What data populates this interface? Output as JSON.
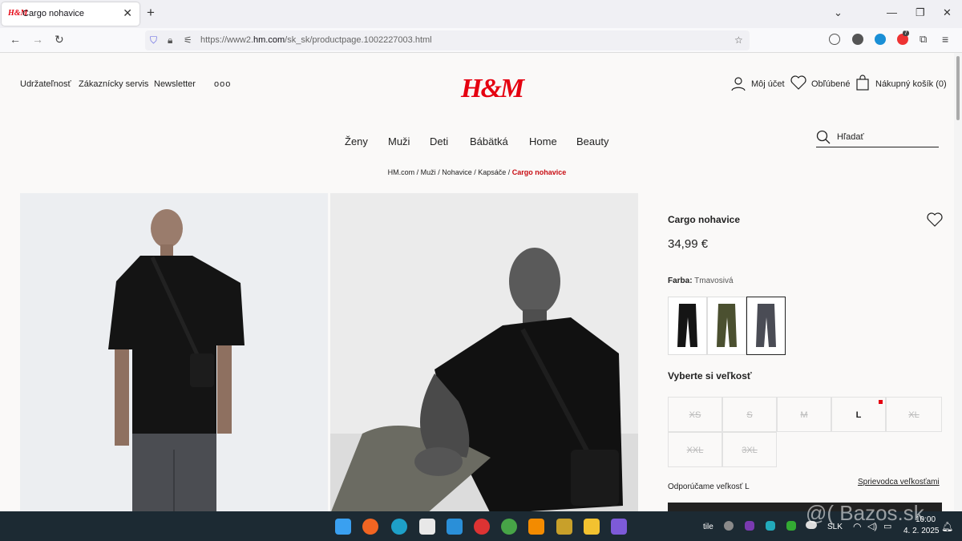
{
  "browser": {
    "tab_title": "Cargo nohavice",
    "tab_favicon_text": "H&M",
    "url_prefix": "https://www2.",
    "url_domain": "hm.com",
    "url_path": "/sk_sk/productpage.1002227003.html",
    "extension_badge": "7"
  },
  "header": {
    "links": [
      "Udržateľnosť",
      "Zákaznícky servis",
      "Newsletter"
    ],
    "more": "ooo",
    "logo": "H&M",
    "account": "Môj účet",
    "favorites": "Obľúbené",
    "cart": "Nákupný košík (0)"
  },
  "nav": {
    "items": [
      "Ženy",
      "Muži",
      "Deti",
      "Bábätká",
      "Home",
      "Beauty"
    ],
    "search_placeholder": "Hľadať"
  },
  "breadcrumb": {
    "items": [
      "HM.com",
      "Muži",
      "Nohavice",
      "Kapsáče"
    ],
    "current": "Cargo nohavice"
  },
  "product": {
    "name": "Cargo nohavice",
    "price": "34,99 €",
    "color_label": "Farba:",
    "color_value": "Tmavosivá",
    "swatches": [
      "black",
      "khaki",
      "dark-grey"
    ],
    "selected_swatch": 2,
    "size_title": "Vyberte si veľkosť",
    "sizes": [
      {
        "label": "XS",
        "available": false
      },
      {
        "label": "S",
        "available": false
      },
      {
        "label": "M",
        "available": false
      },
      {
        "label": "L",
        "available": true
      },
      {
        "label": "XL",
        "available": false
      },
      {
        "label": "XXL",
        "available": false
      },
      {
        "label": "3XL",
        "available": false
      }
    ],
    "recommend": "Odporúčame veľkosť L",
    "size_guide": "Sprievodca veľkosťami"
  },
  "taskbar": {
    "lang_text": "tile",
    "keyboard": "SLK",
    "time": "10:00",
    "date": "4. 2. 2025",
    "watermark": "@( Bazos.sk"
  },
  "colors": {
    "brand": "#e50010",
    "breadcrumb_current": "#c80d13",
    "taskbar": "#1c2a33"
  }
}
